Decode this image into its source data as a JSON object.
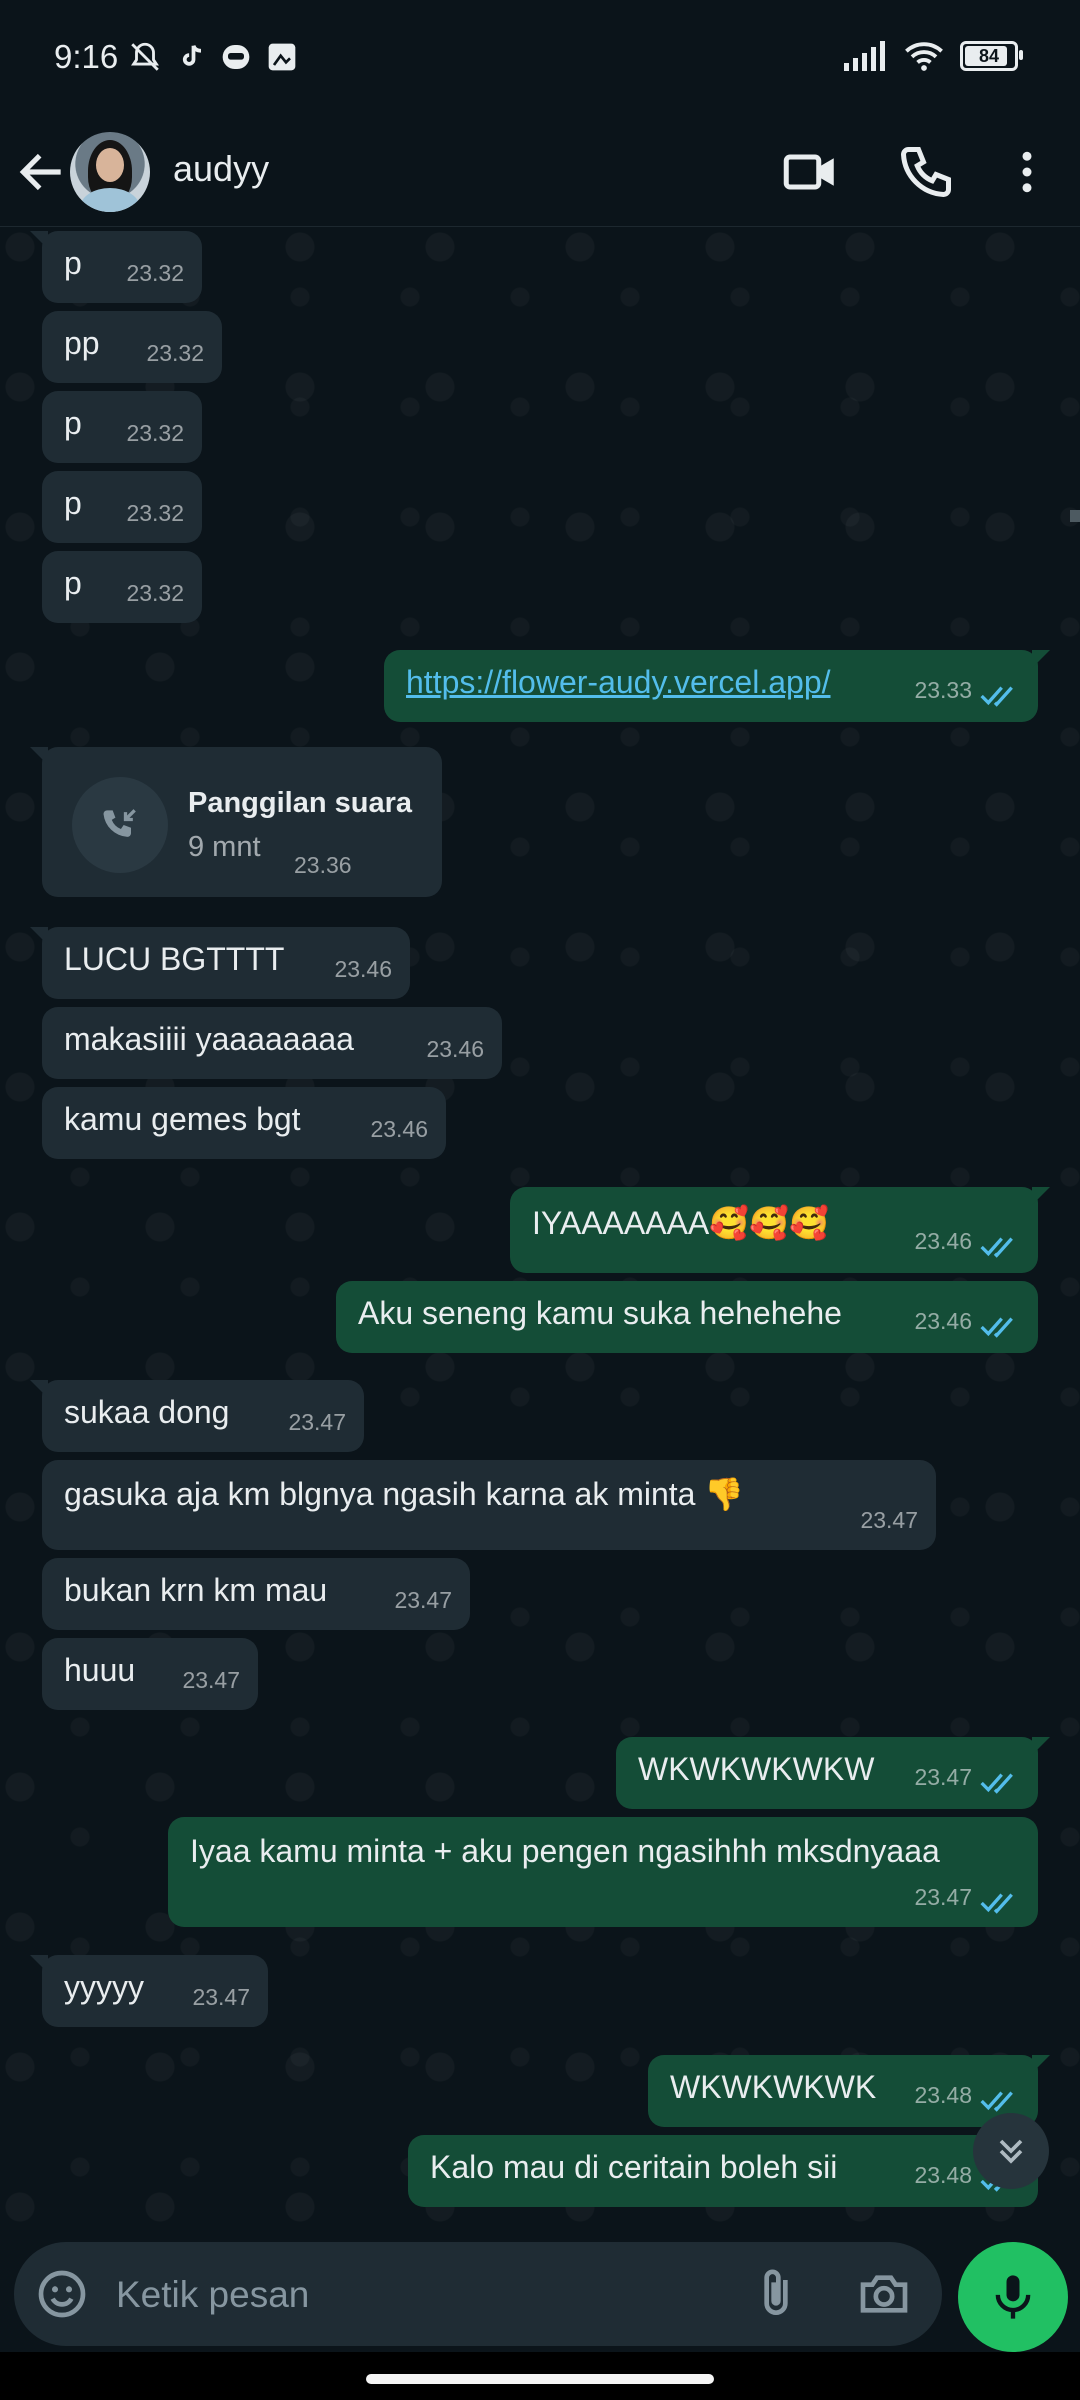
{
  "status_bar": {
    "time": "9:16",
    "battery": "84"
  },
  "header": {
    "contact_name": "audyy"
  },
  "messages": [
    {
      "text": "p",
      "time": "23.32"
    },
    {
      "text": "pp",
      "time": "23.32"
    },
    {
      "text": "p",
      "time": "23.32"
    },
    {
      "text": "p",
      "time": "23.32"
    },
    {
      "text": "p",
      "time": "23.32"
    },
    {
      "text": "https://flower-audy.vercel.app/",
      "time": "23.33"
    },
    {
      "call_title": "Panggilan suara",
      "call_duration": "9 mnt",
      "time": "23.36"
    },
    {
      "text": "LUCU BGTTTT",
      "time": "23.46"
    },
    {
      "text": "makasiiii yaaaaaaaa",
      "time": "23.46"
    },
    {
      "text": "kamu gemes bgt",
      "time": "23.46"
    },
    {
      "text": "IYAAAAAAA🥰🥰🥰",
      "time": "23.46"
    },
    {
      "text": "Aku seneng kamu suka hehehehe",
      "time": "23.46"
    },
    {
      "text": "sukaa dong",
      "time": "23.47"
    },
    {
      "text": "gasuka aja km blgnya ngasih karna ak minta 👎",
      "time": "23.47"
    },
    {
      "text": "bukan krn km mau",
      "time": "23.47"
    },
    {
      "text": "huuu",
      "time": "23.47"
    },
    {
      "text": "WKWKWKWKW",
      "time": "23.47"
    },
    {
      "text": "Iyaa kamu minta + aku pengen ngasihhh mksdnyaaa",
      "time": "23.47"
    },
    {
      "text": "yyyyy",
      "time": "23.47"
    },
    {
      "text": "WKWKWKWK",
      "time": "23.48"
    },
    {
      "text": "Kalo mau di ceritain boleh sii",
      "time": "23.48"
    }
  ],
  "composer": {
    "placeholder": "Ketik pesan"
  },
  "colors": {
    "incoming": "#1f2c34",
    "outgoing": "#144d37",
    "accent": "#21c063",
    "read_ticks": "#53bdeb"
  }
}
